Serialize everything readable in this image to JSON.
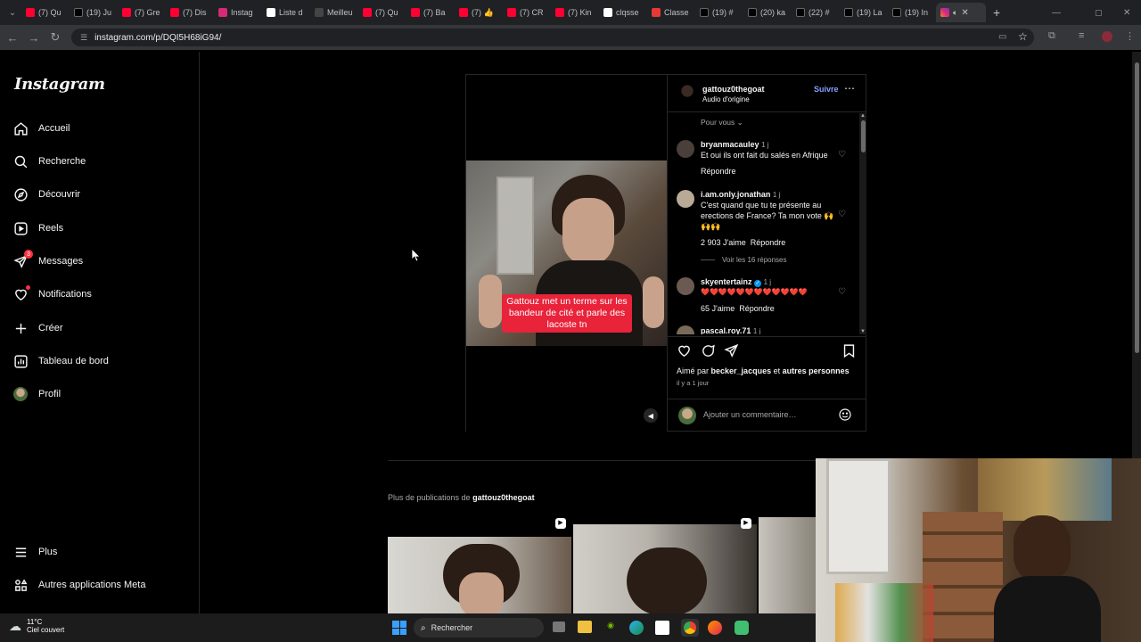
{
  "browser": {
    "tabs": [
      {
        "label": "(7) Qu",
        "icon": "youtube-icon",
        "color": "#ff0033"
      },
      {
        "label": "(19) Ju",
        "icon": "x-icon",
        "color": "#000000"
      },
      {
        "label": "(7) Gre",
        "icon": "youtube-icon",
        "color": "#ff0033"
      },
      {
        "label": "(7) Dis",
        "icon": "youtube-icon",
        "color": "#ff0033"
      },
      {
        "label": "Instag",
        "icon": "instagram-icon",
        "color": "#d62976"
      },
      {
        "label": "Liste d",
        "icon": "wikipedia-icon",
        "color": "#ffffff"
      },
      {
        "label": "Meilleu",
        "icon": "chatgpt-icon",
        "color": "#444444"
      },
      {
        "label": "(7) Qu",
        "icon": "youtube-icon",
        "color": "#ff0033"
      },
      {
        "label": "(7) Ba",
        "icon": "youtube-icon",
        "color": "#ff0033"
      },
      {
        "label": "(7) 👍",
        "icon": "youtube-icon",
        "color": "#ff0033"
      },
      {
        "label": "(7) CR",
        "icon": "youtube-icon",
        "color": "#ff0033"
      },
      {
        "label": "(7) Kin",
        "icon": "youtube-icon",
        "color": "#ff0033"
      },
      {
        "label": "clqsse",
        "icon": "google-icon",
        "color": "#ffffff"
      },
      {
        "label": "Classe",
        "icon": "classement-icon",
        "color": "#e53935"
      },
      {
        "label": "(19) #",
        "icon": "x-icon",
        "color": "#000000"
      },
      {
        "label": "(20) ka",
        "icon": "x-icon",
        "color": "#000000"
      },
      {
        "label": "(22) #",
        "icon": "x-icon",
        "color": "#000000"
      },
      {
        "label": "(19) La",
        "icon": "x-icon",
        "color": "#000000"
      },
      {
        "label": "(19) In",
        "icon": "x-icon",
        "color": "#000000"
      }
    ],
    "url": "instagram.com/p/DQI5H68iG94/"
  },
  "sidebar": {
    "logo": "Instagram",
    "items": [
      {
        "label": "Accueil",
        "icon": "home-icon"
      },
      {
        "label": "Recherche",
        "icon": "search-icon"
      },
      {
        "label": "Découvrir",
        "icon": "compass-icon"
      },
      {
        "label": "Reels",
        "icon": "reels-icon"
      },
      {
        "label": "Messages",
        "icon": "messenger-icon",
        "badge": "3"
      },
      {
        "label": "Notifications",
        "icon": "heart-icon"
      },
      {
        "label": "Créer",
        "icon": "plus-icon"
      },
      {
        "label": "Tableau de bord",
        "icon": "dashboard-icon"
      },
      {
        "label": "Profil",
        "icon": "avatar-icon"
      }
    ],
    "bottom": [
      {
        "label": "Plus",
        "icon": "menu-icon"
      },
      {
        "label": "Autres applications Meta",
        "icon": "meta-apps-icon"
      }
    ]
  },
  "post": {
    "username": "gattouz0thegoat",
    "follow": "Suivre",
    "audio": "Audio d'origine",
    "caption": "Gattouz met un terme sur les bandeur de cité et parle des lacoste tn",
    "sort": "Pour vous",
    "comments": [
      {
        "user": "bryanmacauley",
        "time": "1 j",
        "text": "Et oui ils ont fait du salés en Afrique",
        "likes": "",
        "reply": "Répondre"
      },
      {
        "user": "i.am.only.jonathan",
        "time": "1 j",
        "text": "C'est quand que tu te présente au erections de France? Ta mon vote 🙌🙌🙌",
        "likes": "2 903 J'aime",
        "reply": "Répondre"
      },
      {
        "user": "skyentertainz",
        "time": "1 j",
        "text": "❤️❤️❤️❤️❤️❤️❤️❤️❤️❤️❤️❤️",
        "likes": "65 J'aime",
        "reply": "Répondre"
      },
      {
        "user": "pascal.roy.71",
        "time": "1 j",
        "text": "",
        "likes": "",
        "reply": ""
      }
    ],
    "view_replies": "Voir les 16 réponses",
    "liked_by_prefix": "Aimé par",
    "liked_by_user": "becker_jacques",
    "liked_by_and": "et",
    "liked_by_others": "autres personnes",
    "posted_time": "il y a 1 jour",
    "comment_placeholder": "Ajouter un commentaire…"
  },
  "more": {
    "prefix": "Plus de publications de",
    "user": "gattouz0thegoat"
  },
  "taskbar": {
    "temp": "11°C",
    "weather": "Ciel couvert",
    "search": "Rechercher"
  }
}
